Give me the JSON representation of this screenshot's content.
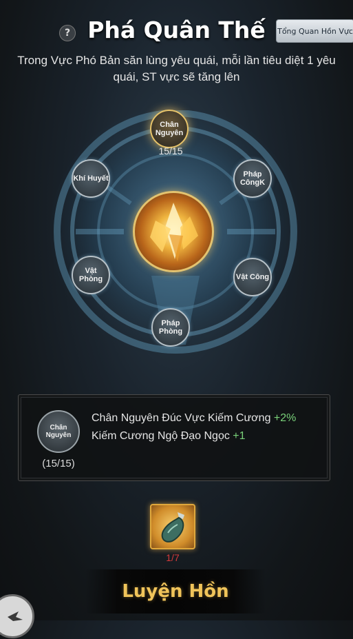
{
  "header": {
    "title": "Phá Quân Thế",
    "help_icon": "?",
    "overview_button": "Tổng Quan Hồn Vực",
    "description": "Trong Vực Phó Bản săn lùng yêu quái, mỗi lần tiêu diệt 1 yêu quái, ST vực sẽ tăng lên"
  },
  "wheel": {
    "nodes": {
      "top": {
        "label": "Chân Nguyên",
        "count": "15/15"
      },
      "upper_left": {
        "label": "Khí Huyết"
      },
      "upper_right": {
        "label": "Pháp CôngK"
      },
      "lower_left": {
        "label": "Vật Phòng"
      },
      "lower_right": {
        "label": "Vật Công"
      },
      "bottom": {
        "label": "Pháp Phòng"
      }
    },
    "core_icon": "golden-crystal-icon"
  },
  "detail_panel": {
    "node_label": "Chân Nguyên",
    "node_count": "(15/15)",
    "line1_text": "Chân Nguyên Đúc Vực Kiếm Cương",
    "line1_bonus": "+2%",
    "line2_text": "Kiếm Cương Ngộ Đạo Ngọc",
    "line2_bonus": "+1"
  },
  "material": {
    "icon": "jade-flask-icon",
    "count": "1/7"
  },
  "action": {
    "refine_label": "Luyện Hồn"
  },
  "colors": {
    "accent_gold": "#e3c370",
    "bonus_green": "#7ad27a",
    "insufficient_red": "#d43a3a"
  }
}
